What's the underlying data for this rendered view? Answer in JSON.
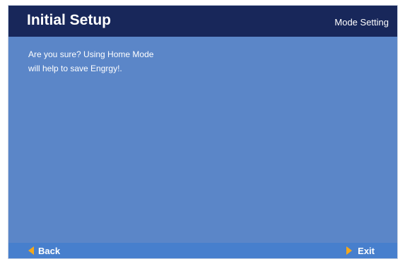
{
  "header": {
    "title": "Initial Setup",
    "section": "Mode Setting"
  },
  "message": {
    "line1": "Are you sure? Using Home Mode",
    "line2": "will help to save Engrgy!."
  },
  "footer": {
    "back_label": "Back",
    "back_icon": "left-triangle-arrow",
    "exit_label": "Exit",
    "exit_icon": "right-triangle-arrow"
  },
  "colors": {
    "header_bg": "#18275a",
    "body_bg": "#5b86c8",
    "footer_bg": "#477fcd",
    "arrow": "#f5a81a",
    "text": "#ffffff"
  }
}
